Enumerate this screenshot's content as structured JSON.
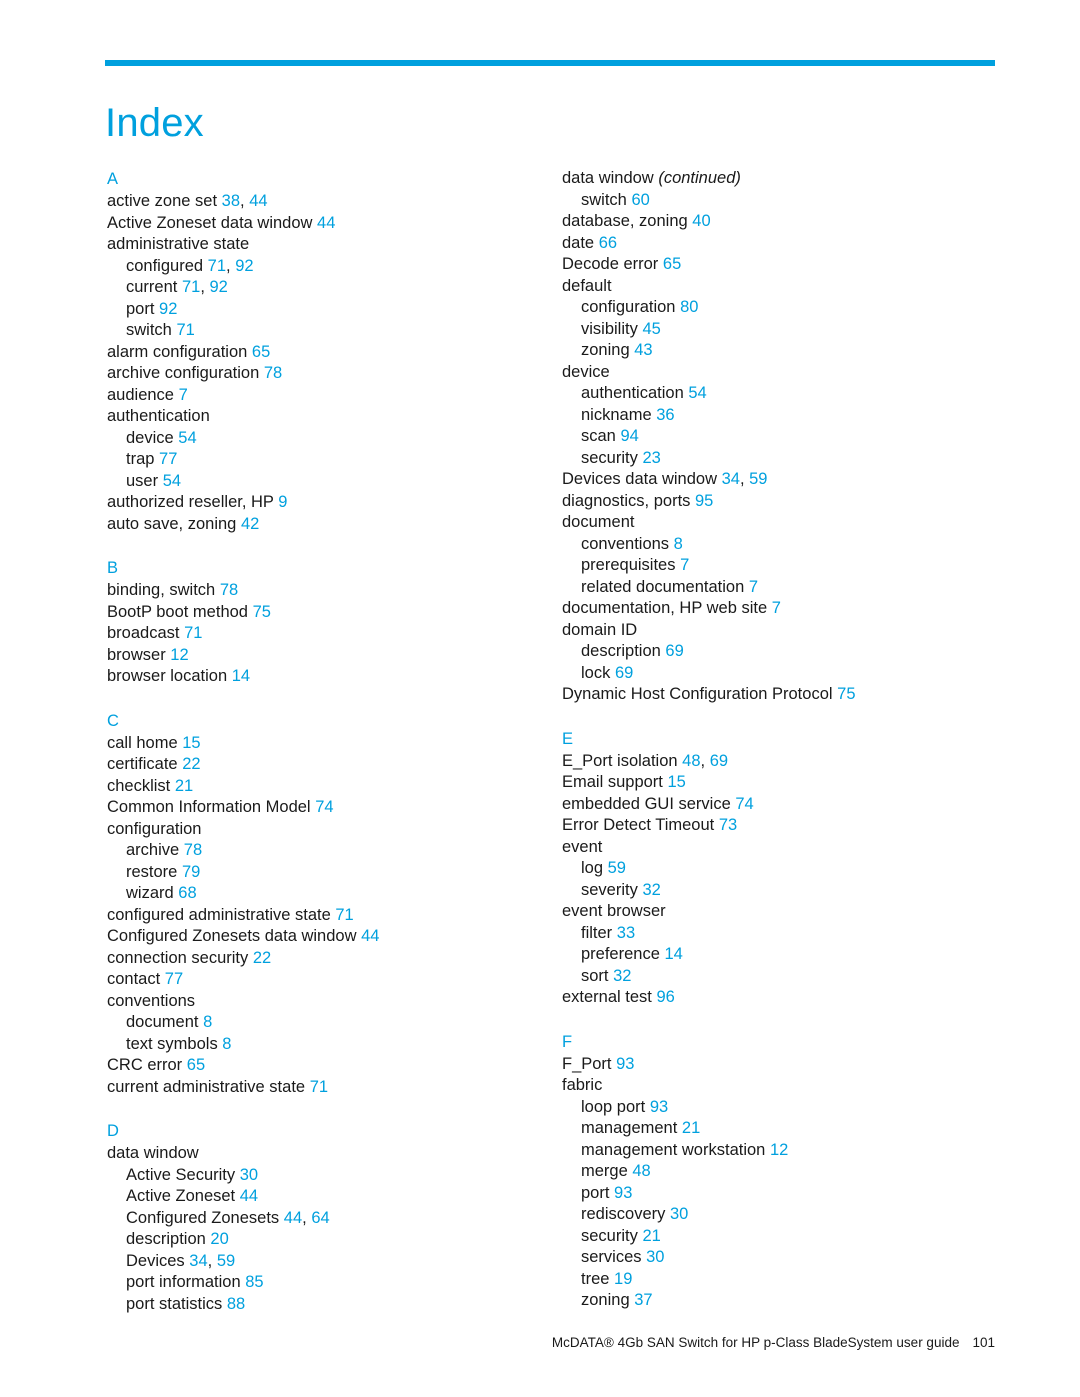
{
  "header": {
    "title": "Index",
    "rule_color": "#00a0de"
  },
  "colors": {
    "accent": "#00a0de",
    "text": "#1a1a1a",
    "background": "#ffffff"
  },
  "columns": {
    "left": [
      {
        "letter": "A",
        "entries": [
          {
            "level": 0,
            "text": "active zone set",
            "pages": [
              "38",
              "44"
            ]
          },
          {
            "level": 0,
            "text": "Active Zoneset data window",
            "pages": [
              "44"
            ]
          },
          {
            "level": 0,
            "text": "administrative state",
            "pages": []
          },
          {
            "level": 1,
            "text": "configured",
            "pages": [
              "71",
              "92"
            ]
          },
          {
            "level": 1,
            "text": "current",
            "pages": [
              "71",
              "92"
            ]
          },
          {
            "level": 1,
            "text": "port",
            "pages": [
              "92"
            ]
          },
          {
            "level": 1,
            "text": "switch",
            "pages": [
              "71"
            ]
          },
          {
            "level": 0,
            "text": "alarm configuration",
            "pages": [
              "65"
            ]
          },
          {
            "level": 0,
            "text": "archive configuration",
            "pages": [
              "78"
            ]
          },
          {
            "level": 0,
            "text": "audience",
            "pages": [
              "7"
            ]
          },
          {
            "level": 0,
            "text": "authentication",
            "pages": []
          },
          {
            "level": 1,
            "text": "device",
            "pages": [
              "54"
            ]
          },
          {
            "level": 1,
            "text": "trap",
            "pages": [
              "77"
            ]
          },
          {
            "level": 1,
            "text": "user",
            "pages": [
              "54"
            ]
          },
          {
            "level": 0,
            "text": "authorized reseller, HP",
            "pages": [
              "9"
            ]
          },
          {
            "level": 0,
            "text": "auto save, zoning",
            "pages": [
              "42"
            ]
          }
        ]
      },
      {
        "letter": "B",
        "entries": [
          {
            "level": 0,
            "text": "binding, switch",
            "pages": [
              "78"
            ]
          },
          {
            "level": 0,
            "text": "BootP boot method",
            "pages": [
              "75"
            ]
          },
          {
            "level": 0,
            "text": "broadcast",
            "pages": [
              "71"
            ]
          },
          {
            "level": 0,
            "text": "browser",
            "pages": [
              "12"
            ]
          },
          {
            "level": 0,
            "text": "browser location",
            "pages": [
              "14"
            ]
          }
        ]
      },
      {
        "letter": "C",
        "entries": [
          {
            "level": 0,
            "text": "call home",
            "pages": [
              "15"
            ]
          },
          {
            "level": 0,
            "text": "certificate",
            "pages": [
              "22"
            ]
          },
          {
            "level": 0,
            "text": "checklist",
            "pages": [
              "21"
            ]
          },
          {
            "level": 0,
            "text": "Common Information Model",
            "pages": [
              "74"
            ]
          },
          {
            "level": 0,
            "text": "configuration",
            "pages": []
          },
          {
            "level": 1,
            "text": "archive",
            "pages": [
              "78"
            ]
          },
          {
            "level": 1,
            "text": "restore",
            "pages": [
              "79"
            ]
          },
          {
            "level": 1,
            "text": "wizard",
            "pages": [
              "68"
            ]
          },
          {
            "level": 0,
            "text": "configured administrative state",
            "pages": [
              "71"
            ]
          },
          {
            "level": 0,
            "text": "Configured Zonesets data window",
            "pages": [
              "44"
            ]
          },
          {
            "level": 0,
            "text": "connection security",
            "pages": [
              "22"
            ]
          },
          {
            "level": 0,
            "text": "contact",
            "pages": [
              "77"
            ]
          },
          {
            "level": 0,
            "text": "conventions",
            "pages": []
          },
          {
            "level": 1,
            "text": "document",
            "pages": [
              "8"
            ]
          },
          {
            "level": 1,
            "text": "text symbols",
            "pages": [
              "8"
            ]
          },
          {
            "level": 0,
            "text": "CRC error",
            "pages": [
              "65"
            ]
          },
          {
            "level": 0,
            "text": "current administrative state",
            "pages": [
              "71"
            ]
          }
        ]
      },
      {
        "letter": "D",
        "entries": [
          {
            "level": 0,
            "text": "data window",
            "pages": []
          },
          {
            "level": 1,
            "text": "Active Security",
            "pages": [
              "30"
            ]
          },
          {
            "level": 1,
            "text": "Active Zoneset",
            "pages": [
              "44"
            ]
          },
          {
            "level": 1,
            "text": "Configured Zonesets",
            "pages": [
              "44",
              "64"
            ]
          },
          {
            "level": 1,
            "text": "description",
            "pages": [
              "20"
            ]
          },
          {
            "level": 1,
            "text": "Devices",
            "pages": [
              "34",
              "59"
            ]
          },
          {
            "level": 1,
            "text": "port information",
            "pages": [
              "85"
            ]
          },
          {
            "level": 1,
            "text": "port statistics",
            "pages": [
              "88"
            ]
          }
        ]
      }
    ],
    "right": [
      {
        "letter": "",
        "entries": [
          {
            "level": 0,
            "text": "data window",
            "continued": "(continued)",
            "pages": []
          },
          {
            "level": 1,
            "text": "switch",
            "pages": [
              "60"
            ]
          },
          {
            "level": 0,
            "text": "database, zoning",
            "pages": [
              "40"
            ]
          },
          {
            "level": 0,
            "text": "date",
            "pages": [
              "66"
            ]
          },
          {
            "level": 0,
            "text": "Decode error",
            "pages": [
              "65"
            ]
          },
          {
            "level": 0,
            "text": "default",
            "pages": []
          },
          {
            "level": 1,
            "text": "configuration",
            "pages": [
              "80"
            ]
          },
          {
            "level": 1,
            "text": "visibility",
            "pages": [
              "45"
            ]
          },
          {
            "level": 1,
            "text": "zoning",
            "pages": [
              "43"
            ]
          },
          {
            "level": 0,
            "text": "device",
            "pages": []
          },
          {
            "level": 1,
            "text": "authentication",
            "pages": [
              "54"
            ]
          },
          {
            "level": 1,
            "text": "nickname",
            "pages": [
              "36"
            ]
          },
          {
            "level": 1,
            "text": "scan",
            "pages": [
              "94"
            ]
          },
          {
            "level": 1,
            "text": "security",
            "pages": [
              "23"
            ]
          },
          {
            "level": 0,
            "text": "Devices data window",
            "pages": [
              "34",
              "59"
            ]
          },
          {
            "level": 0,
            "text": "diagnostics, ports",
            "pages": [
              "95"
            ]
          },
          {
            "level": 0,
            "text": "document",
            "pages": []
          },
          {
            "level": 1,
            "text": "conventions",
            "pages": [
              "8"
            ]
          },
          {
            "level": 1,
            "text": "prerequisites",
            "pages": [
              "7"
            ]
          },
          {
            "level": 1,
            "text": "related documentation",
            "pages": [
              "7"
            ]
          },
          {
            "level": 0,
            "text": "documentation, HP web site",
            "pages": [
              "7"
            ]
          },
          {
            "level": 0,
            "text": "domain ID",
            "pages": []
          },
          {
            "level": 1,
            "text": "description",
            "pages": [
              "69"
            ]
          },
          {
            "level": 1,
            "text": "lock",
            "pages": [
              "69"
            ]
          },
          {
            "level": 0,
            "text": "Dynamic Host Configuration Protocol",
            "pages": [
              "75"
            ]
          }
        ]
      },
      {
        "letter": "E",
        "entries": [
          {
            "level": 0,
            "text": "E_Port isolation",
            "pages": [
              "48",
              "69"
            ]
          },
          {
            "level": 0,
            "text": "Email support",
            "pages": [
              "15"
            ]
          },
          {
            "level": 0,
            "text": "embedded GUI service",
            "pages": [
              "74"
            ]
          },
          {
            "level": 0,
            "text": "Error Detect Timeout",
            "pages": [
              "73"
            ]
          },
          {
            "level": 0,
            "text": "event",
            "pages": []
          },
          {
            "level": 1,
            "text": "log",
            "pages": [
              "59"
            ]
          },
          {
            "level": 1,
            "text": "severity",
            "pages": [
              "32"
            ]
          },
          {
            "level": 0,
            "text": "event browser",
            "pages": []
          },
          {
            "level": 1,
            "text": "filter",
            "pages": [
              "33"
            ]
          },
          {
            "level": 1,
            "text": "preference",
            "pages": [
              "14"
            ]
          },
          {
            "level": 1,
            "text": "sort",
            "pages": [
              "32"
            ]
          },
          {
            "level": 0,
            "text": "external test",
            "pages": [
              "96"
            ]
          }
        ]
      },
      {
        "letter": "F",
        "entries": [
          {
            "level": 0,
            "text": "F_Port",
            "pages": [
              "93"
            ]
          },
          {
            "level": 0,
            "text": "fabric",
            "pages": []
          },
          {
            "level": 1,
            "text": "loop port",
            "pages": [
              "93"
            ]
          },
          {
            "level": 1,
            "text": "management",
            "pages": [
              "21"
            ]
          },
          {
            "level": 1,
            "text": "management workstation",
            "pages": [
              "12"
            ]
          },
          {
            "level": 1,
            "text": "merge",
            "pages": [
              "48"
            ]
          },
          {
            "level": 1,
            "text": "port",
            "pages": [
              "93"
            ]
          },
          {
            "level": 1,
            "text": "rediscovery",
            "pages": [
              "30"
            ]
          },
          {
            "level": 1,
            "text": "security",
            "pages": [
              "21"
            ]
          },
          {
            "level": 1,
            "text": "services",
            "pages": [
              "30"
            ]
          },
          {
            "level": 1,
            "text": "tree",
            "pages": [
              "19"
            ]
          },
          {
            "level": 1,
            "text": "zoning",
            "pages": [
              "37"
            ]
          }
        ]
      }
    ]
  },
  "footer": {
    "text": "McDATA® 4Gb SAN Switch for HP p-Class BladeSystem user guide",
    "page_number": "101"
  }
}
